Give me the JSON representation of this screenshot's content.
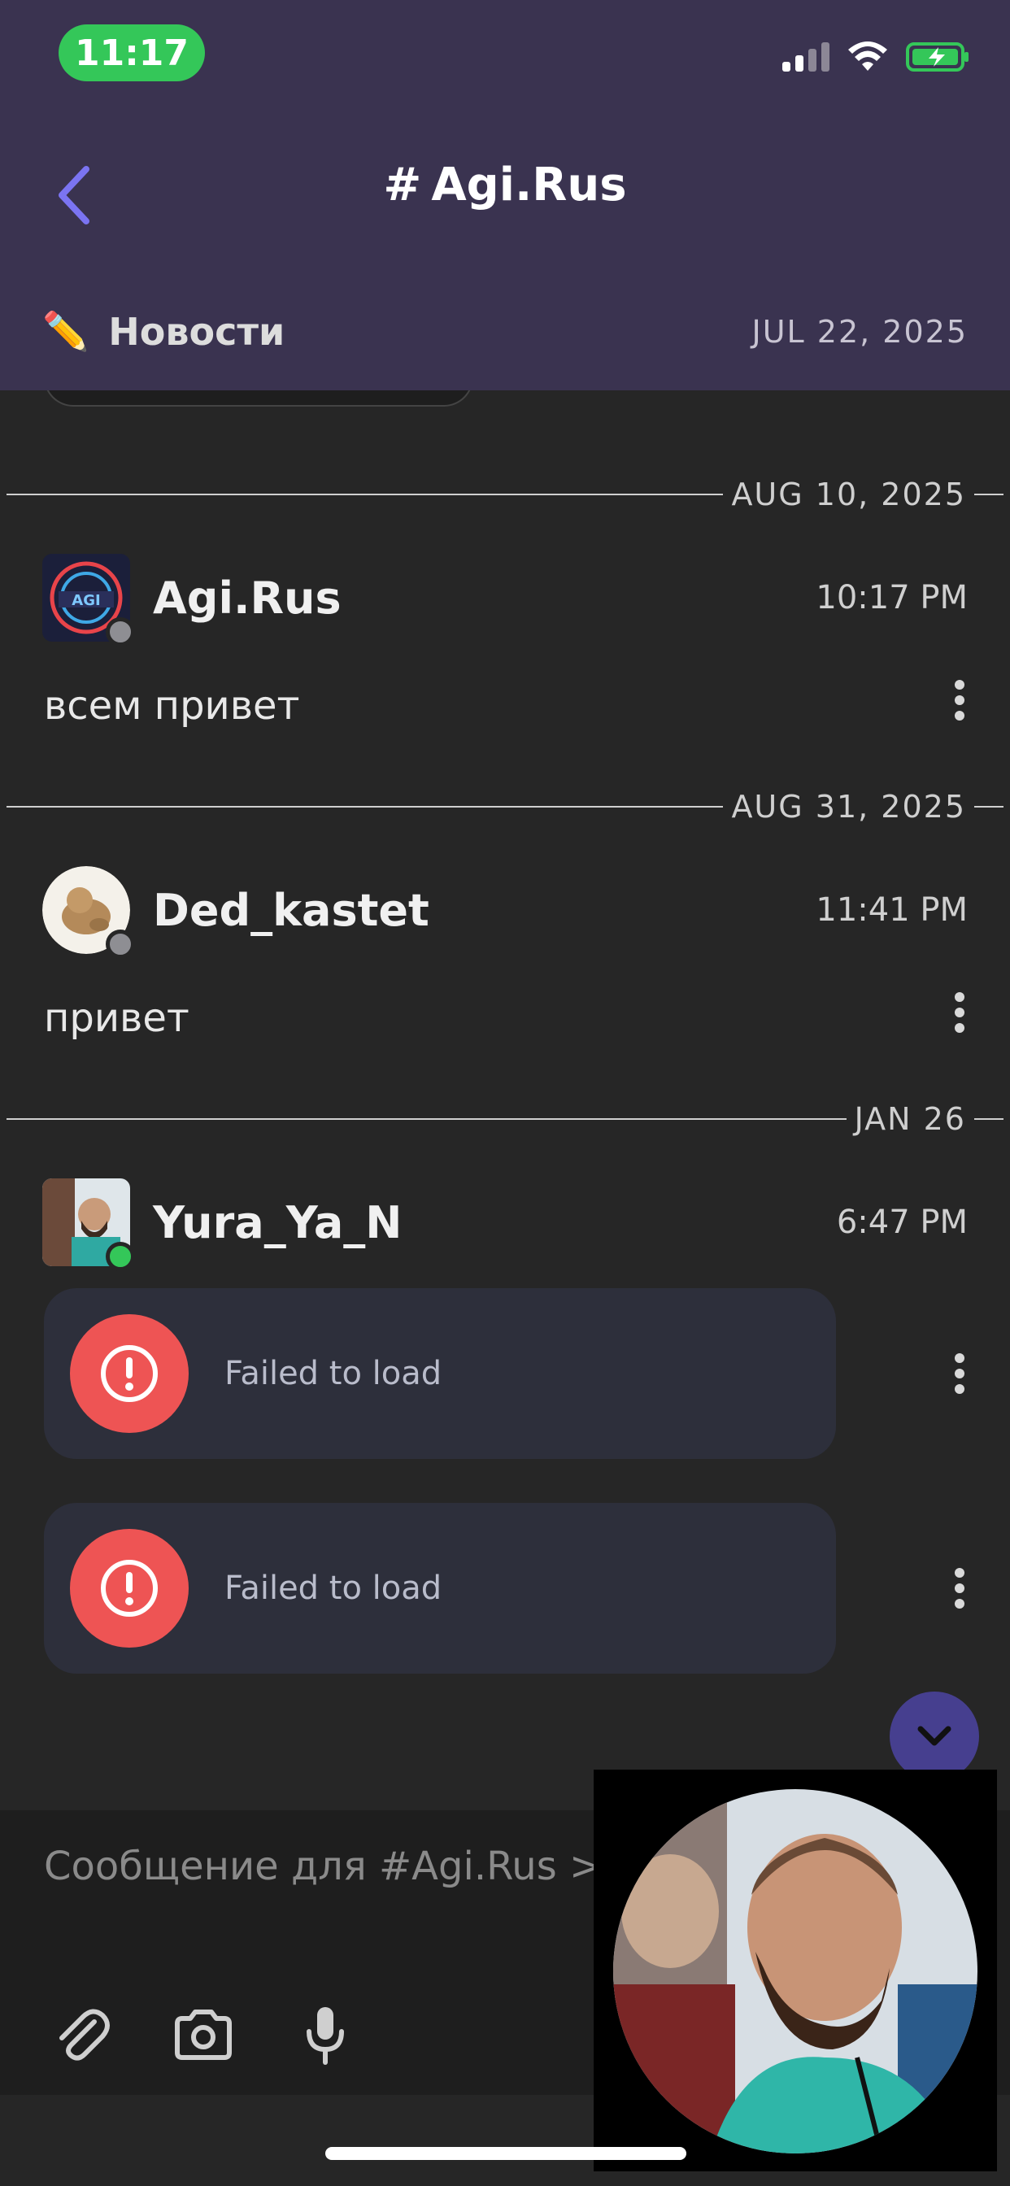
{
  "status_bar": {
    "time": "11:17"
  },
  "header": {
    "title": "Agi.Rus",
    "pinned": {
      "icon": "pencil-icon",
      "label": "Новости",
      "date": "JUL 22, 2025"
    }
  },
  "messages": [
    {
      "date_divider": "AUG 10, 2025",
      "username": "Agi.Rus",
      "time": "10:17 PM",
      "text": "всем привет",
      "presence": "offline"
    },
    {
      "date_divider": "AUG 31, 2025",
      "username": "Ded_kastet",
      "time": "11:41 PM",
      "text": "привет",
      "presence": "offline"
    },
    {
      "date_divider": "JAN 26",
      "username": "Yura_Ya_N",
      "time": "6:47 PM",
      "presence": "online",
      "attachments": [
        {
          "status": "Failed to load"
        },
        {
          "status": "Failed to load"
        }
      ]
    }
  ],
  "composer": {
    "placeholder": "Сообщение для #Agi.Rus > ✏️"
  },
  "colors": {
    "header_bg": "#3a3350",
    "accent": "#7b74f2",
    "online": "#34c759",
    "error": "#ee5454"
  }
}
